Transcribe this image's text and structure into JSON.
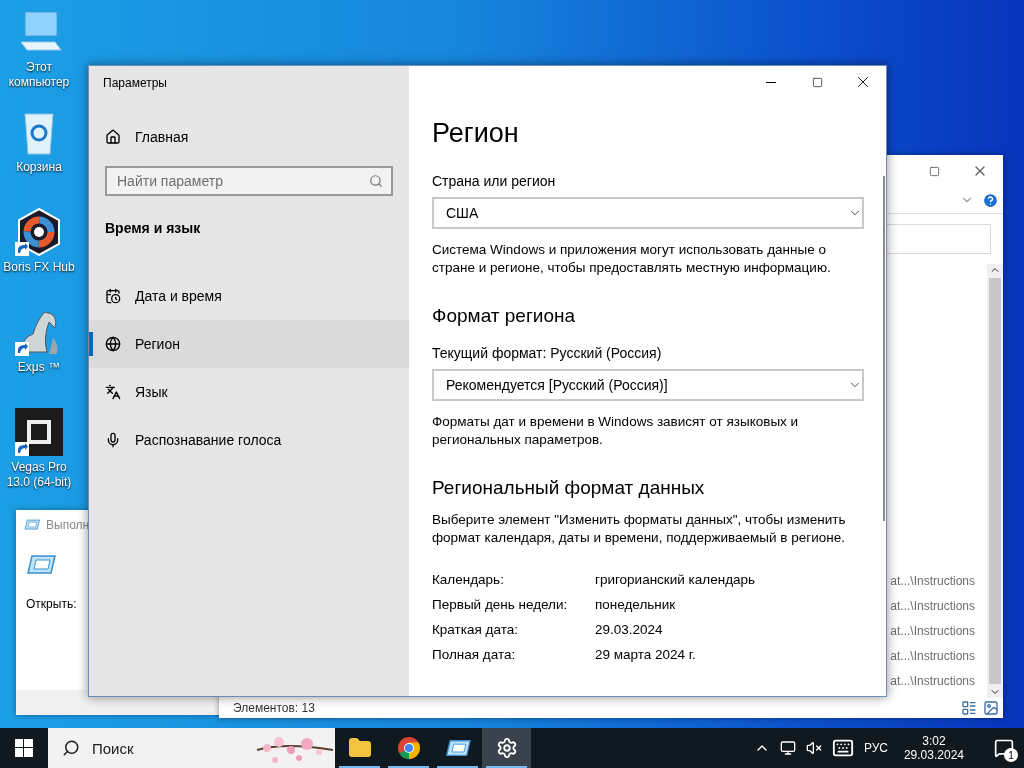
{
  "desktop": {
    "icons": [
      {
        "kind": "computer",
        "label": "Этот компьютер",
        "shortcut": false
      },
      {
        "kind": "bin",
        "label": "Корзина",
        "shortcut": false
      },
      {
        "kind": "hexagon",
        "label": "Boris FX Hub",
        "shortcut": true
      },
      {
        "kind": "figure",
        "label": "Exμs ™",
        "shortcut": true
      },
      {
        "kind": "film",
        "label": "Vegas Pro 13.0 (64-bit)",
        "shortcut": true
      }
    ]
  },
  "explorer": {
    "items": [
      "at...\\Instructions",
      "at...\\Instructions",
      "at...\\Instructions",
      "at...\\Instructions",
      "at...\\Instructions"
    ],
    "status": "Элементов: 13"
  },
  "run_dialog": {
    "title": "Выполн",
    "open_label": "Открыть:"
  },
  "settings": {
    "title": "Параметры",
    "home": "Главная",
    "search": {
      "placeholder": "Найти параметр"
    },
    "section": "Время и язык",
    "nav": [
      {
        "kind": "calendar",
        "label": "Дата и время",
        "selected": false
      },
      {
        "kind": "globe",
        "label": "Регион",
        "selected": true
      },
      {
        "kind": "language",
        "label": "Язык",
        "selected": false
      },
      {
        "kind": "mic",
        "label": "Распознавание голоса",
        "selected": false
      }
    ],
    "page_title": "Регион",
    "country": {
      "label": "Страна или регион",
      "value": "США",
      "note": "Система Windows и приложения могут использовать данные о стране и регионе, чтобы предоставлять местную информацию."
    },
    "format": {
      "heading": "Формат региона",
      "label": "Текущий формат: Русский (Россия)",
      "value": "Рекомендуется [Русский (Россия)]",
      "note": "Форматы дат и времени в Windows зависят от языковых и региональных параметров."
    },
    "data_format": {
      "heading": "Региональный формат данных",
      "note": "Выберите элемент \"Изменить форматы данных\", чтобы изменить формат календаря, даты и времени, поддерживаемый в регионе.",
      "rows": [
        {
          "label": "Календарь:",
          "value": "григорианский календарь"
        },
        {
          "label": "Первый день недели:",
          "value": "понедельник"
        },
        {
          "label": "Краткая дата:",
          "value": "29.03.2024"
        },
        {
          "label": "Полная дата:",
          "value": "29 марта 2024 г."
        }
      ]
    }
  },
  "taskbar": {
    "search": {
      "placeholder": "Поиск"
    },
    "apps": [
      {
        "kind": "folder",
        "selected": false
      },
      {
        "kind": "chrome",
        "selected": false
      },
      {
        "kind": "run",
        "selected": false
      },
      {
        "kind": "settings",
        "selected": true
      }
    ],
    "language": "РУС",
    "time": "3:02",
    "date": "29.03.2024",
    "notifications": "1"
  }
}
